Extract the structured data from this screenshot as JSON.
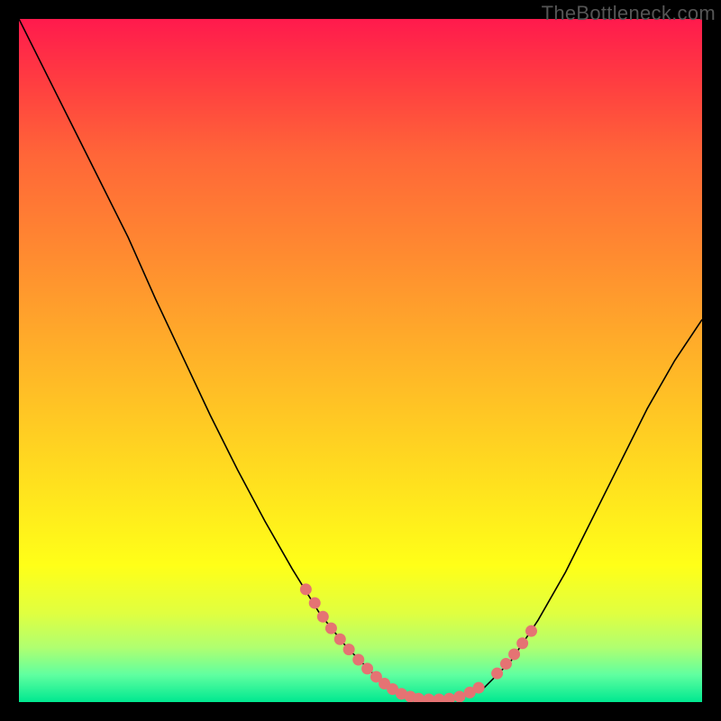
{
  "watermark": "TheBottleneck.com",
  "chart_data": {
    "type": "line",
    "title": "",
    "xlabel": "",
    "ylabel": "",
    "xlim": [
      0,
      100
    ],
    "ylim": [
      0,
      100
    ],
    "series": [
      {
        "name": "curve",
        "x": [
          0,
          2,
          5,
          8,
          12,
          16,
          20,
          24,
          28,
          32,
          36,
          40,
          44,
          48,
          52,
          56,
          60,
          64,
          68,
          72,
          76,
          80,
          84,
          88,
          92,
          96,
          100
        ],
        "y": [
          100,
          96,
          90,
          84,
          76,
          68,
          59,
          50.5,
          42,
          34,
          26.5,
          19.5,
          13,
          8,
          4,
          1.5,
          0.5,
          0.5,
          2,
          6,
          12,
          19,
          27,
          35,
          43,
          50,
          56
        ]
      }
    ],
    "markers": {
      "name": "highlight-dots",
      "color": "#e57373",
      "points": [
        {
          "x": 42,
          "y": 16.5
        },
        {
          "x": 43.3,
          "y": 14.5
        },
        {
          "x": 44.5,
          "y": 12.5
        },
        {
          "x": 45.7,
          "y": 10.8
        },
        {
          "x": 47,
          "y": 9.2
        },
        {
          "x": 48.3,
          "y": 7.7
        },
        {
          "x": 49.7,
          "y": 6.2
        },
        {
          "x": 51,
          "y": 4.9
        },
        {
          "x": 52.3,
          "y": 3.7
        },
        {
          "x": 53.5,
          "y": 2.7
        },
        {
          "x": 54.7,
          "y": 1.9
        },
        {
          "x": 56,
          "y": 1.2
        },
        {
          "x": 57.3,
          "y": 0.8
        },
        {
          "x": 58.5,
          "y": 0.5
        },
        {
          "x": 60,
          "y": 0.4
        },
        {
          "x": 61.5,
          "y": 0.4
        },
        {
          "x": 63,
          "y": 0.5
        },
        {
          "x": 64.5,
          "y": 0.8
        },
        {
          "x": 66,
          "y": 1.4
        },
        {
          "x": 67.3,
          "y": 2.1
        },
        {
          "x": 70,
          "y": 4.2
        },
        {
          "x": 71.3,
          "y": 5.6
        },
        {
          "x": 72.5,
          "y": 7
        },
        {
          "x": 73.7,
          "y": 8.6
        },
        {
          "x": 75,
          "y": 10.4
        }
      ]
    }
  }
}
